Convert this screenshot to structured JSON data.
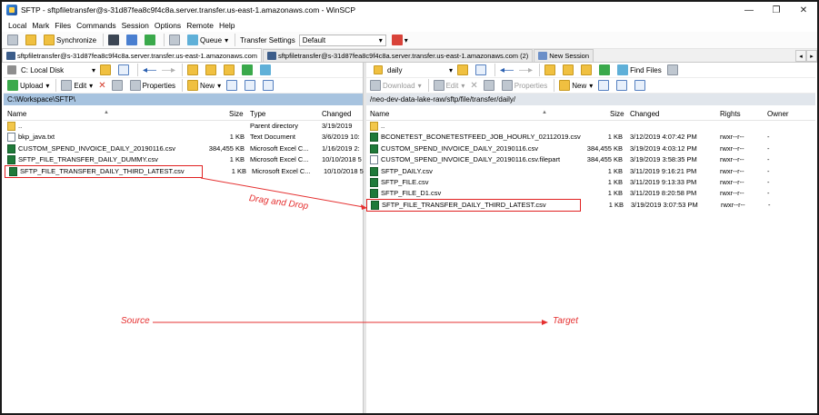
{
  "window": {
    "title": "SFTP - sftpfiletransfer@s-31d87fea8c9f4c8a.server.transfer.us-east-1.amazonaws.com - WinSCP"
  },
  "menu": [
    "Local",
    "Mark",
    "Files",
    "Commands",
    "Session",
    "Options",
    "Remote",
    "Help"
  ],
  "toolbar": {
    "synchronize": "Synchronize",
    "queue": "Queue",
    "transfer_settings_label": "Transfer Settings",
    "transfer_settings_value": "Default"
  },
  "tabs": [
    "sftpfiletransfer@s-31d87fea8c9f4c8a.server.transfer.us-east-1.amazonaws.com",
    "sftpfiletransfer@s-31d87fea8c9f4c8a.server.transfer.us-east-1.amazonaws.com (2)",
    "New Session"
  ],
  "left": {
    "drive": "C: Local Disk",
    "upload": "Upload",
    "edit": "Edit",
    "properties": "Properties",
    "new": "New",
    "path": "C:\\Workspace\\SFTP\\",
    "columns": [
      "Name",
      "Size",
      "Type",
      "Changed"
    ],
    "files": [
      {
        "name": "..",
        "size": "",
        "type": "Parent directory",
        "changed": "3/19/2019",
        "icon": "up-folder-icon"
      },
      {
        "name": "bkp_java.txt",
        "size": "1 KB",
        "type": "Text Document",
        "changed": "3/6/2019  10:",
        "icon": "text-file-icon"
      },
      {
        "name": "CUSTOM_SPEND_INVOICE_DAILY_20190116.csv",
        "size": "384,455 KB",
        "type": "Microsoft Excel C...",
        "changed": "1/16/2019  2:",
        "icon": "excel-file-icon"
      },
      {
        "name": "SFTP_FILE_TRANSFER_DAILY_DUMMY.csv",
        "size": "1 KB",
        "type": "Microsoft Excel C...",
        "changed": "10/10/2018  5:",
        "icon": "excel-file-icon"
      },
      {
        "name": "SFTP_FILE_TRANSFER_DAILY_THIRD_LATEST.csv",
        "size": "1 KB",
        "type": "Microsoft Excel C...",
        "changed": "10/10/2018  5:",
        "icon": "excel-file-icon"
      }
    ]
  },
  "right": {
    "folder": "daily",
    "find_files": "Find Files",
    "download": "Download",
    "edit": "Edit",
    "properties": "Properties",
    "new": "New",
    "path": "/neo-dev-data-lake-raw/sftp/file/transfer/daily/",
    "columns": [
      "Name",
      "Size",
      "Changed",
      "Rights",
      "Owner"
    ],
    "files": [
      {
        "name": "..",
        "size": "",
        "changed": "",
        "rights": "",
        "owner": "",
        "icon": "up-folder-icon"
      },
      {
        "name": "BCONETEST_BCONETESTFEED_JOB_HOURLY_02112019.csv",
        "size": "1 KB",
        "changed": "3/12/2019 4:07:42 PM",
        "rights": "rwxr--r--",
        "owner": "-",
        "icon": "excel-file-icon"
      },
      {
        "name": "CUSTOM_SPEND_INVOICE_DAILY_20190116.csv",
        "size": "384,455 KB",
        "changed": "3/19/2019 4:03:12 PM",
        "rights": "rwxr--r--",
        "owner": "-",
        "icon": "excel-file-icon"
      },
      {
        "name": "CUSTOM_SPEND_INVOICE_DAILY_20190116.csv.filepart",
        "size": "384,455 KB",
        "changed": "3/19/2019 3:58:35 PM",
        "rights": "rwxr--r--",
        "owner": "-",
        "icon": "text-file-icon"
      },
      {
        "name": "SFTP_DAILY.csv",
        "size": "1 KB",
        "changed": "3/11/2019 9:16:21 PM",
        "rights": "rwxr--r--",
        "owner": "-",
        "icon": "excel-file-icon"
      },
      {
        "name": "SFTP_FILE.csv",
        "size": "1 KB",
        "changed": "3/11/2019 9:13:33 PM",
        "rights": "rwxr--r--",
        "owner": "-",
        "icon": "excel-file-icon"
      },
      {
        "name": "SFTP_FILE_D1.csv",
        "size": "1 KB",
        "changed": "3/11/2019 8:20:58 PM",
        "rights": "rwxr--r--",
        "owner": "-",
        "icon": "excel-file-icon"
      },
      {
        "name": "SFTP_FILE_TRANSFER_DAILY_THIRD_LATEST.csv",
        "size": "1 KB",
        "changed": "3/19/2019 3:07:53 PM",
        "rights": "rwxr--r--",
        "owner": "-",
        "icon": "excel-file-icon"
      }
    ]
  },
  "annotations": {
    "drag": "Drag and Drop",
    "source": "Source",
    "target": "Target",
    "color": "#e53030"
  }
}
